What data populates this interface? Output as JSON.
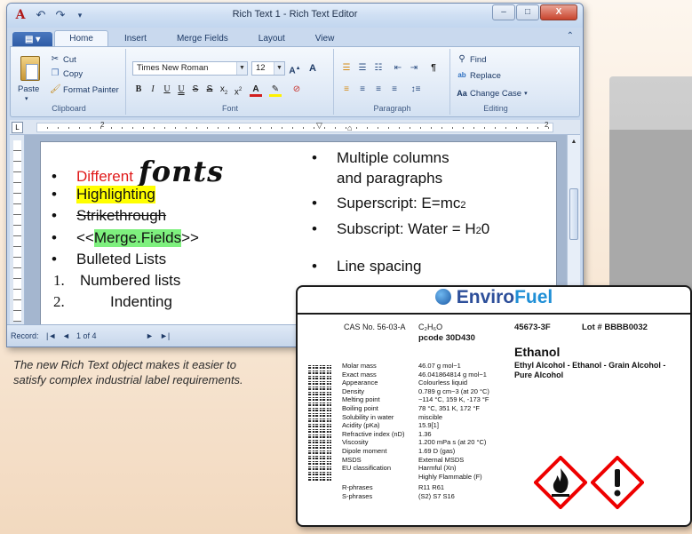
{
  "window": {
    "title": "Rich Text 1 - Rich Text Editor",
    "app_icon": "A",
    "minimize": "–",
    "maximize": "□",
    "close": "X"
  },
  "tabs": [
    "Home",
    "Insert",
    "Merge Fields",
    "Layout",
    "View"
  ],
  "ribbon": {
    "clipboard": {
      "label": "Clipboard",
      "paste": "Paste",
      "cut": "Cut",
      "copy": "Copy",
      "format_painter": "Format Painter"
    },
    "font": {
      "label": "Font",
      "font_name": "Times New Roman",
      "font_size": "12"
    },
    "paragraph": {
      "label": "Paragraph"
    },
    "editing": {
      "label": "Editing",
      "find": "Find",
      "replace": "Replace",
      "change_case": "Change Case"
    }
  },
  "ruler": {
    "left_num": "2",
    "right_num": "2"
  },
  "document": {
    "left_column": {
      "different": "Different",
      "fonts": "fonts",
      "highlighting": "Highlighting",
      "strikethrough": "Strikethrough",
      "merge_open": "<<",
      "merge_field": "Merge.Fields",
      "merge_close": ">>",
      "bulleted": "Bulleted Lists",
      "num1": "1.",
      "numbered": "Numbered lists",
      "num2": "2.",
      "indenting": "Indenting"
    },
    "right_column": {
      "multi1": "Multiple columns",
      "multi2": "and paragraphs",
      "superscript": "Superscript: E=mc",
      "sup": "2",
      "subscript": "Subscript: Water = H",
      "sub": "2",
      "sub_tail": "0",
      "line_spacing": "Line spacing"
    }
  },
  "statusbar": {
    "record_label": "Record:",
    "first": "|◄",
    "prev": "◄",
    "record": "1 of 4",
    "next": "►",
    "last": "►|"
  },
  "caption": "The new Rich Text object makes it easier to satisfy complex industrial label requirements.",
  "label": {
    "brand_a": "Enviro",
    "brand_b": "Fuel",
    "cas": "CAS No. 56-03-A",
    "formula": "C₂H₆O",
    "pcode": "pcode 30D430",
    "part": "45673-3F",
    "lot": "Lot # BBBB0032",
    "name": "Ethanol",
    "synonyms": "Ethyl Alcohol - Ethanol - Grain Alcohol - Pure Alcohol",
    "properties": [
      [
        "Molar mass",
        "46.07 g mol−1"
      ],
      [
        "Exact mass",
        "46.041864814 g mol−1"
      ],
      [
        "Appearance",
        "Colourless liquid"
      ],
      [
        "Density",
        "0.789 g cm−3 (at 20 °C)"
      ],
      [
        "Melting point",
        "−114 °C, 159 K, -173 °F"
      ],
      [
        "Boiling point",
        "78 °C, 351 K, 172 °F"
      ],
      [
        "Solubility in water",
        "miscible"
      ],
      [
        "Acidity (pKa)",
        "15.9[1]"
      ],
      [
        "Refractive index (nD)",
        "1.36"
      ],
      [
        "Viscosity",
        "1.200 mPa s (at 20 °C)"
      ],
      [
        "Dipole moment",
        "1.69 D (gas)"
      ],
      [
        "MSDS",
        "External MSDS"
      ],
      [
        "EU classification",
        "Harmful (Xn)"
      ],
      [
        "",
        "Highly Flammable (F)"
      ],
      [
        "R-phrases",
        "R11 R61"
      ],
      [
        "S-phrases",
        "(S2) S7 S16"
      ]
    ]
  }
}
